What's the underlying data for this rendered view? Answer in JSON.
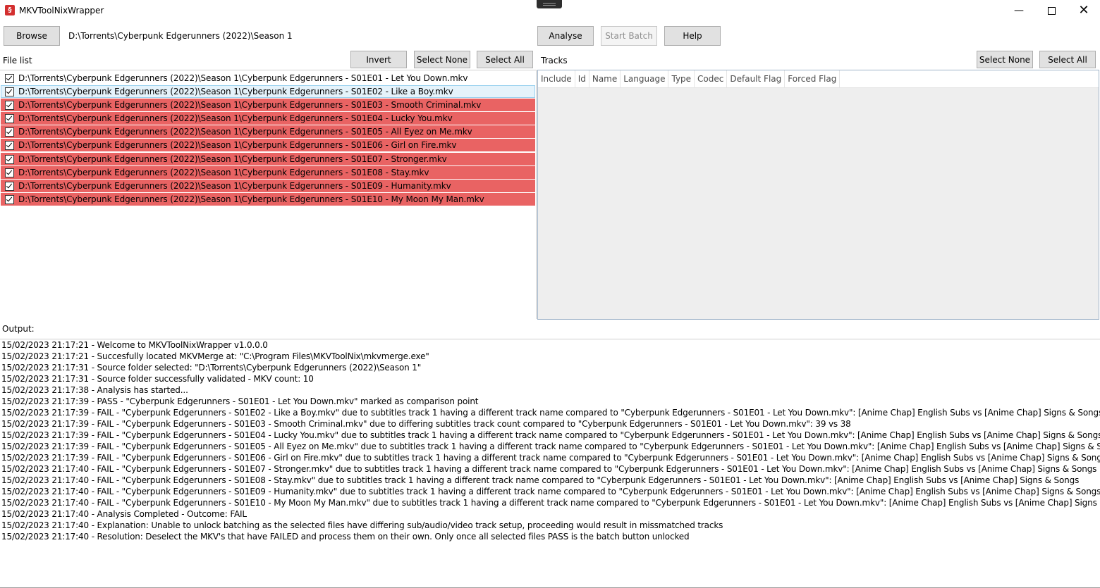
{
  "window": {
    "title": "MKVToolNixWrapper",
    "icon": "app-logo-icon",
    "controls": [
      "minimize-icon",
      "maximize-icon",
      "close-icon"
    ]
  },
  "toolbar": {
    "browse_label": "Browse",
    "path": "D:\\Torrents\\Cyberpunk Edgerunners (2022)\\Season 1",
    "analyse_label": "Analyse",
    "start_batch_label": "Start Batch",
    "help_label": "Help"
  },
  "file_list": {
    "label": "File list",
    "invert_label": "Invert",
    "select_none_label": "Select None",
    "select_all_label": "Select All",
    "items": [
      {
        "path": "D:\\Torrents\\Cyberpunk Edgerunners (2022)\\Season 1\\Cyberpunk Edgerunners - S01E01 - Let You Down.mkv",
        "checked": true,
        "status": "pass"
      },
      {
        "path": "D:\\Torrents\\Cyberpunk Edgerunners (2022)\\Season 1\\Cyberpunk Edgerunners - S01E02 - Like a Boy.mkv",
        "checked": true,
        "status": "selected"
      },
      {
        "path": "D:\\Torrents\\Cyberpunk Edgerunners (2022)\\Season 1\\Cyberpunk Edgerunners - S01E03 - Smooth Criminal.mkv",
        "checked": true,
        "status": "fail"
      },
      {
        "path": "D:\\Torrents\\Cyberpunk Edgerunners (2022)\\Season 1\\Cyberpunk Edgerunners - S01E04 - Lucky You.mkv",
        "checked": true,
        "status": "fail"
      },
      {
        "path": "D:\\Torrents\\Cyberpunk Edgerunners (2022)\\Season 1\\Cyberpunk Edgerunners - S01E05 - All Eyez on Me.mkv",
        "checked": true,
        "status": "fail"
      },
      {
        "path": "D:\\Torrents\\Cyberpunk Edgerunners (2022)\\Season 1\\Cyberpunk Edgerunners - S01E06 - Girl on Fire.mkv",
        "checked": true,
        "status": "fail"
      },
      {
        "path": "D:\\Torrents\\Cyberpunk Edgerunners (2022)\\Season 1\\Cyberpunk Edgerunners - S01E07 - Stronger.mkv",
        "checked": true,
        "status": "fail"
      },
      {
        "path": "D:\\Torrents\\Cyberpunk Edgerunners (2022)\\Season 1\\Cyberpunk Edgerunners - S01E08 - Stay.mkv",
        "checked": true,
        "status": "fail"
      },
      {
        "path": "D:\\Torrents\\Cyberpunk Edgerunners (2022)\\Season 1\\Cyberpunk Edgerunners - S01E09 - Humanity.mkv",
        "checked": true,
        "status": "fail"
      },
      {
        "path": "D:\\Torrents\\Cyberpunk Edgerunners (2022)\\Season 1\\Cyberpunk Edgerunners - S01E10 - My Moon My Man.mkv",
        "checked": true,
        "status": "fail"
      }
    ]
  },
  "tracks": {
    "label": "Tracks",
    "select_none_label": "Select None",
    "select_all_label": "Select All",
    "columns": [
      "Include",
      "Id",
      "Name",
      "Language",
      "Type",
      "Codec",
      "Default Flag",
      "Forced Flag"
    ]
  },
  "output": {
    "label": "Output:",
    "lines": [
      "15/02/2023 21:17:21 - Welcome to MKVToolNixWrapper v1.0.0.0",
      "15/02/2023 21:17:21 - Succesfully located MKVMerge at: \"C:\\Program Files\\MKVToolNix\\mkvmerge.exe\"",
      "15/02/2023 21:17:31 - Source folder selected: \"D:\\Torrents\\Cyberpunk Edgerunners (2022)\\Season 1\"",
      "15/02/2023 21:17:31 - Source folder successfully validated - MKV count: 10",
      "15/02/2023 21:17:38 - Analysis has started...",
      "15/02/2023 21:17:39 - PASS - \"Cyberpunk Edgerunners - S01E01 - Let You Down.mkv\" marked as comparison point",
      "15/02/2023 21:17:39 - FAIL - \"Cyberpunk Edgerunners - S01E02 - Like a Boy.mkv\" due to subtitles track 1 having a different track name compared to \"Cyberpunk Edgerunners - S01E01 - Let You Down.mkv\": [Anime Chap] English Subs vs [Anime Chap] Signs & Songs",
      "15/02/2023 21:17:39 - FAIL - \"Cyberpunk Edgerunners - S01E03 - Smooth Criminal.mkv\" due to differing subtitles track count compared to \"Cyberpunk Edgerunners - S01E01 - Let You Down.mkv\": 39 vs 38",
      "15/02/2023 21:17:39 - FAIL - \"Cyberpunk Edgerunners - S01E04 - Lucky You.mkv\" due to subtitles track 1 having a different track name compared to \"Cyberpunk Edgerunners - S01E01 - Let You Down.mkv\": [Anime Chap] English Subs vs [Anime Chap] Signs & Songs",
      "15/02/2023 21:17:39 - FAIL - \"Cyberpunk Edgerunners - S01E05 - All Eyez on Me.mkv\" due to subtitles track 1 having a different track name compared to \"Cyberpunk Edgerunners - S01E01 - Let You Down.mkv\": [Anime Chap] English Subs vs [Anime Chap] Signs & Songs",
      "15/02/2023 21:17:39 - FAIL - \"Cyberpunk Edgerunners - S01E06 - Girl on Fire.mkv\" due to subtitles track 1 having a different track name compared to \"Cyberpunk Edgerunners - S01E01 - Let You Down.mkv\": [Anime Chap] English Subs vs [Anime Chap] Signs & Songs",
      "15/02/2023 21:17:40 - FAIL - \"Cyberpunk Edgerunners - S01E07 - Stronger.mkv\" due to subtitles track 1 having a different track name compared to \"Cyberpunk Edgerunners - S01E01 - Let You Down.mkv\": [Anime Chap] English Subs vs [Anime Chap] Signs & Songs",
      "15/02/2023 21:17:40 - FAIL - \"Cyberpunk Edgerunners - S01E08 - Stay.mkv\" due to subtitles track 1 having a different track name compared to \"Cyberpunk Edgerunners - S01E01 - Let You Down.mkv\": [Anime Chap] English Subs vs [Anime Chap] Signs & Songs",
      "15/02/2023 21:17:40 - FAIL - \"Cyberpunk Edgerunners - S01E09 - Humanity.mkv\" due to subtitles track 1 having a different track name compared to \"Cyberpunk Edgerunners - S01E01 - Let You Down.mkv\": [Anime Chap] English Subs vs [Anime Chap] Signs & Songs",
      "15/02/2023 21:17:40 - FAIL - \"Cyberpunk Edgerunners - S01E10 - My Moon My Man.mkv\" due to subtitles track 1 having a different track name compared to \"Cyberpunk Edgerunners - S01E01 - Let You Down.mkv\": [Anime Chap] English Subs vs [Anime Chap] Signs & Songs",
      "15/02/2023 21:17:40 - Analysis Completed - Outcome: FAIL",
      "15/02/2023 21:17:40 - Explanation: Unable to unlock batching as the selected files have differing sub/audio/video track setup, proceeding would result in missmatched tracks",
      "15/02/2023 21:17:40 - Resolution: Deselect the MKV's that have FAILED and process them on their own. Only once all selected files PASS is the batch button unlocked"
    ]
  },
  "colors": {
    "fail_row": "#e96363",
    "selected_row": "#e5f3fb",
    "button_face": "#e1e1e1",
    "accent": "#d32f2f"
  }
}
